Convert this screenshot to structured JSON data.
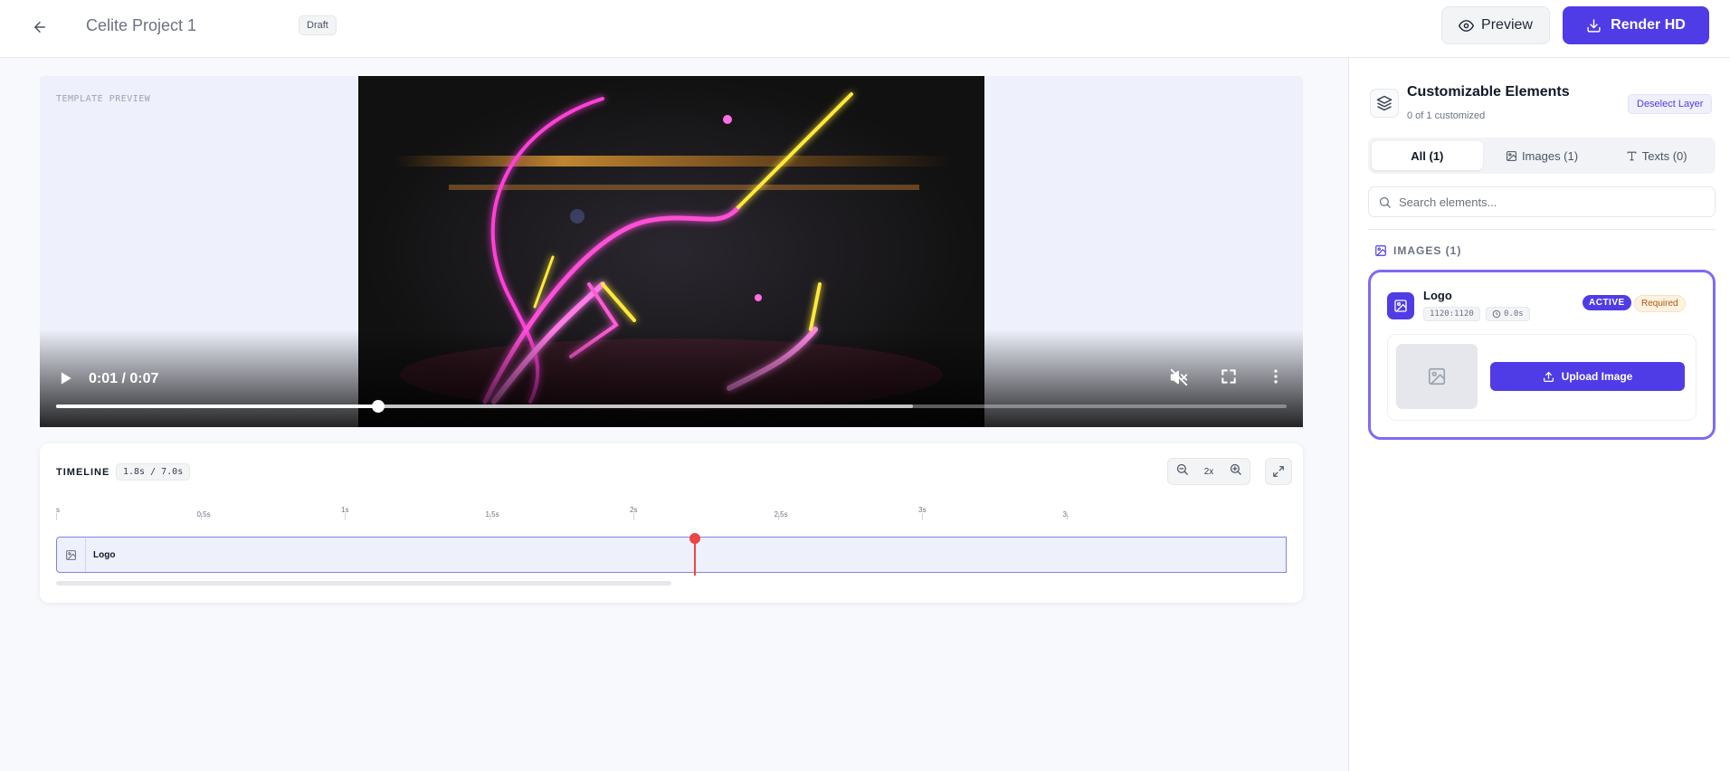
{
  "header": {
    "project_title": "Celite Project 1",
    "status_badge": "Draft",
    "preview_label": "Preview",
    "render_label": "Render HD"
  },
  "video": {
    "template_label": "TEMPLATE PREVIEW",
    "time_display": "0:01 / 0:07",
    "progress_fraction": 0.262,
    "buffered_fraction": 0.696
  },
  "timeline": {
    "title": "TIMELINE",
    "time_display": "1.8s / 7.0s",
    "zoom_value": "2x",
    "ruler_labels": [
      "s",
      "0.5s",
      "1s",
      "1.5s",
      "2s",
      "2.5s",
      "3s",
      "3."
    ],
    "track_label": "Logo",
    "playhead_seconds": 1.8
  },
  "panel": {
    "title": "Customizable Elements",
    "subtitle": "0 of 1 customized",
    "deselect_label": "Deselect Layer",
    "tabs": [
      {
        "label": "All (1)",
        "active": true
      },
      {
        "label": "Images (1)",
        "active": false
      },
      {
        "label": "Texts (0)",
        "active": false
      }
    ],
    "search_placeholder": "Search elements...",
    "section_title": "IMAGES (1)",
    "card": {
      "title": "Logo",
      "dimensions": "1120:1120",
      "duration": "0.0s",
      "active_badge": "ACTIVE",
      "required_badge": "Required",
      "upload_label": "Upload Image"
    }
  },
  "colors": {
    "accent": "#4f3ce6",
    "card_border": "#7d6cf2",
    "playhead": "#ef4444",
    "required_text": "#b45309"
  }
}
